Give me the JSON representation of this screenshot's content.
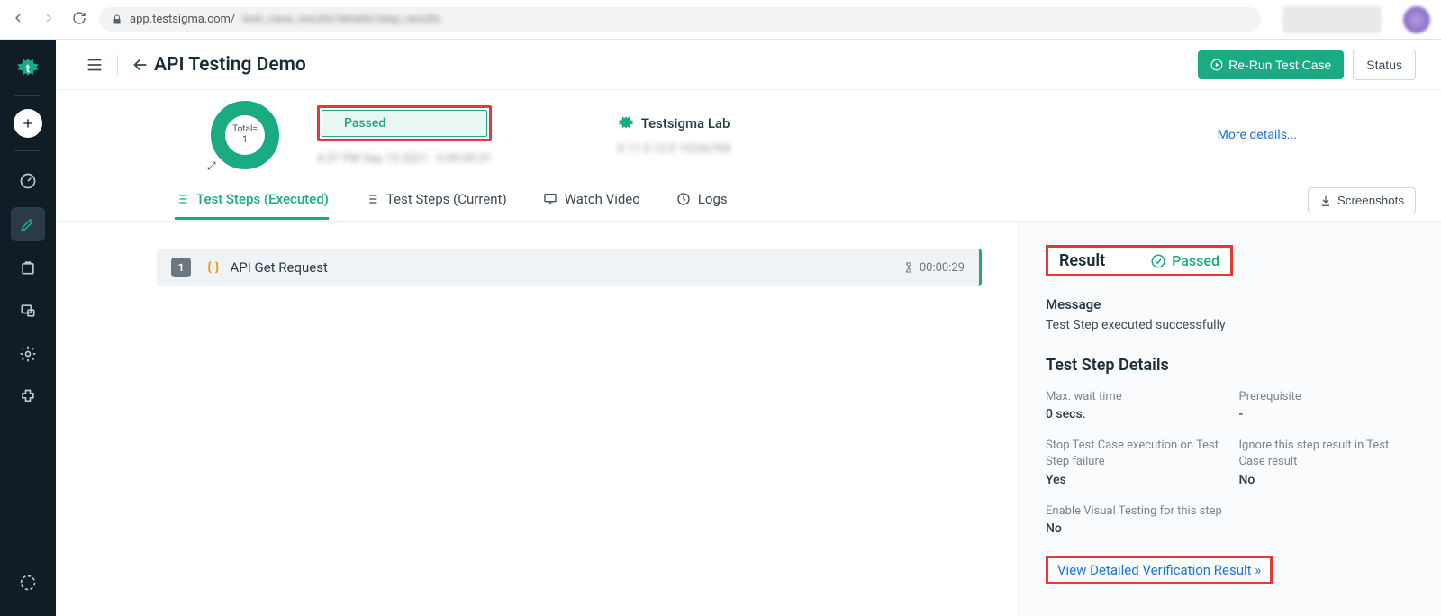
{
  "browser": {
    "url_prefix": "app.testsigma.com/",
    "url_rest": "test_case_results/details/step_results"
  },
  "header": {
    "title": "API Testing Demo",
    "rerun_label": "Re-Run Test Case",
    "status_btn": "Status"
  },
  "summary": {
    "donut": {
      "total_label": "Total=",
      "total_value": "1"
    },
    "status_badge": "Passed",
    "summary_blur_1": "4:37 PM Sep 15 2021 · 0:00:00:31",
    "lab_name": "Testsigma Lab",
    "summary_blur_2": "0.11   0.12.0   1024x768",
    "more_link": "More details..."
  },
  "tabs": {
    "executed": "Test Steps (Executed)",
    "current": "Test Steps (Current)",
    "watch": "Watch Video",
    "logs": "Logs",
    "screenshots": "Screenshots"
  },
  "steps": [
    {
      "num": "1",
      "icon": "{·}",
      "name": "API Get Request",
      "time": "00:00:29"
    }
  ],
  "panel": {
    "result_label": "Result",
    "result_value": "Passed",
    "message_label": "Message",
    "message_value": "Test Step executed successfully",
    "details_header": "Test Step Details",
    "rows": {
      "max_wait": {
        "k": "Max. wait time",
        "v": "0 secs."
      },
      "prereq": {
        "k": "Prerequisite",
        "v": "-"
      },
      "stop": {
        "k": "Stop Test Case execution on Test Step failure",
        "v": "Yes"
      },
      "ignore": {
        "k": "Ignore this step result in Test Case result",
        "v": "No"
      },
      "visual": {
        "k": "Enable Visual Testing for this step",
        "v": "No"
      }
    },
    "detail_link": "View Detailed Verification Result »"
  }
}
